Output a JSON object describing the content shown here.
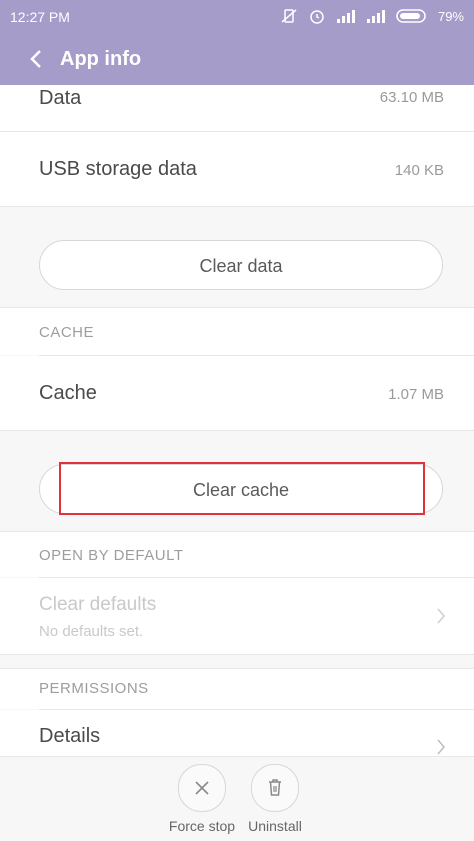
{
  "status_bar": {
    "time": "12:27 PM",
    "battery": "79%",
    "icons": [
      "vibrate-off-icon",
      "alarm-icon",
      "signal-icon",
      "signal-icon",
      "battery-icon"
    ]
  },
  "app_bar": {
    "title": "App info"
  },
  "storage": {
    "data_label": "Data",
    "data_value": "63.10 MB",
    "usb_label": "USB storage data",
    "usb_value": "140 KB",
    "clear_data": "Clear data"
  },
  "cache": {
    "section_title": "CACHE",
    "label": "Cache",
    "value": "1.07 MB",
    "clear_cache": "Clear cache"
  },
  "open_by_default": {
    "section_title": "OPEN BY DEFAULT",
    "title": "Clear defaults",
    "subtitle": "No defaults set."
  },
  "permissions": {
    "section_title": "PERMISSIONS",
    "details": "Details"
  },
  "bottom_bar": {
    "force_stop": "Force stop",
    "uninstall": "Uninstall"
  },
  "colors": {
    "accent": "#a59cc9",
    "highlight": "#e0323a"
  }
}
